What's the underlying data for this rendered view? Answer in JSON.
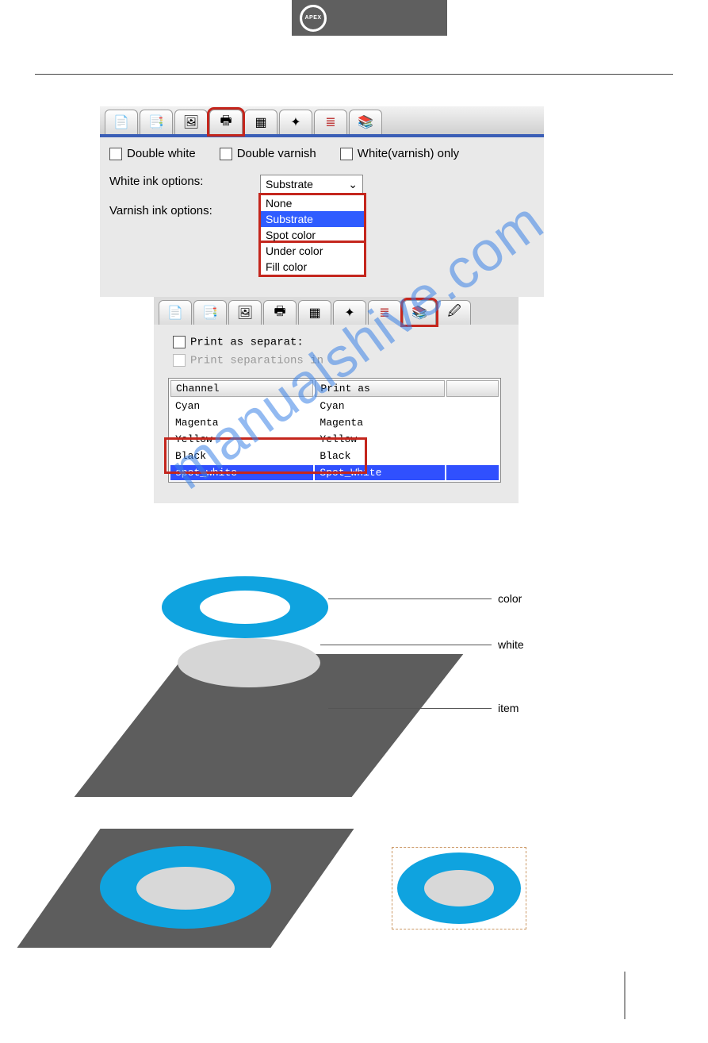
{
  "logo_text": "APEX",
  "panel1": {
    "checkboxes": {
      "double_white": "Double white",
      "double_varnish": "Double varnish",
      "white_only": "White(varnish) only"
    },
    "white_label": "White ink options:",
    "varnish_label": "Varnish ink options:",
    "combo_selected": "Substrate",
    "combo_chevron": "⌄",
    "options": [
      "None",
      "Substrate",
      "Spot color",
      "Under color",
      "Fill color"
    ]
  },
  "panel2": {
    "cb1": "Print as separat:",
    "cb2": "Print separations in",
    "headers": [
      "Channel",
      "Print as"
    ],
    "rows": [
      [
        "Cyan",
        "Cyan"
      ],
      [
        "Magenta",
        "Magenta"
      ],
      [
        "Yellow",
        "Yellow"
      ],
      [
        "Black",
        "Black"
      ],
      [
        "spot_white",
        "Spot_White"
      ]
    ]
  },
  "watermark": "manualshive.com",
  "diagram_labels": {
    "color": "color",
    "white": "white",
    "item": "item"
  },
  "icons": {
    "page": "📄",
    "newpage": "📑",
    "image": "🖼",
    "printer": "🖶",
    "grid": "▦",
    "target": "✦",
    "colors": "≣",
    "stack": "📚",
    "picker": "🖉"
  }
}
